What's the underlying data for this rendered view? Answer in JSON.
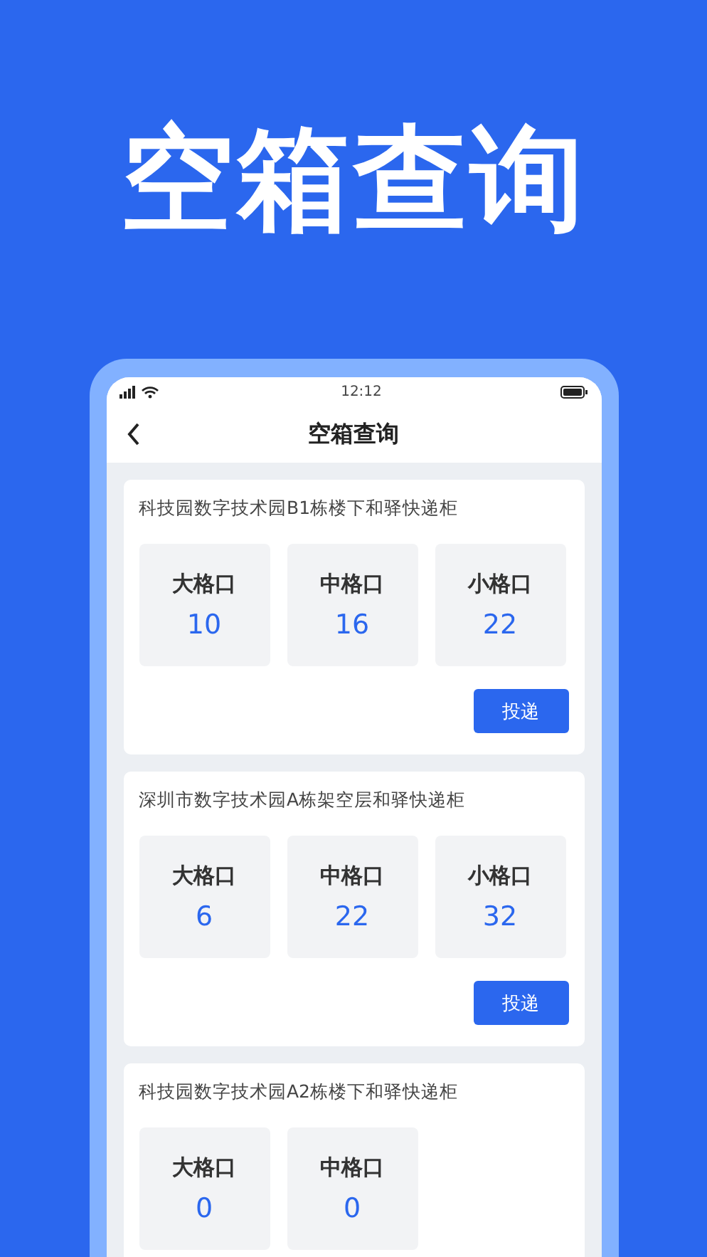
{
  "headline": "空箱查询",
  "status_bar": {
    "time": "12:12"
  },
  "nav": {
    "title": "空箱查询"
  },
  "lockers": [
    {
      "name": "科技园数字技术园B1栋楼下和驿快递柜",
      "slots": [
        {
          "label": "大格口",
          "count": "10"
        },
        {
          "label": "中格口",
          "count": "16"
        },
        {
          "label": "小格口",
          "count": "22"
        }
      ],
      "action": "投递"
    },
    {
      "name": "深圳市数字技术园A栋架空层和驿快递柜",
      "slots": [
        {
          "label": "大格口",
          "count": "6"
        },
        {
          "label": "中格口",
          "count": "22"
        },
        {
          "label": "小格口",
          "count": "32"
        }
      ],
      "action": "投递"
    },
    {
      "name": "科技园数字技术园A2栋楼下和驿快递柜",
      "slots": [
        {
          "label": "大格口",
          "count": "0"
        },
        {
          "label": "中格口",
          "count": "0"
        }
      ]
    }
  ]
}
